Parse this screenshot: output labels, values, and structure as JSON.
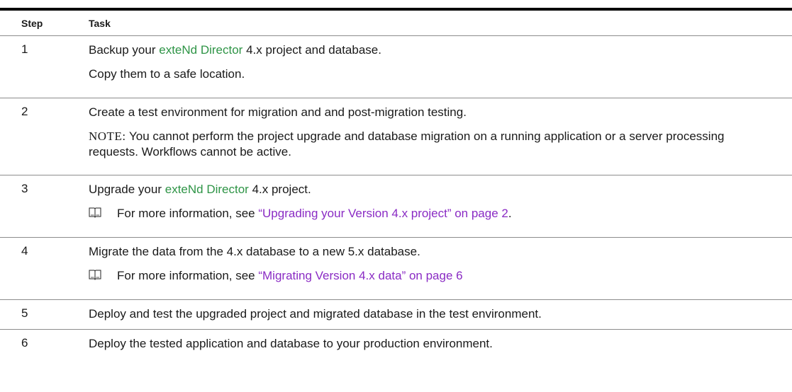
{
  "header": {
    "step": "Step",
    "task": "Task"
  },
  "rows": [
    {
      "step": "1",
      "line1": {
        "a": "Backup your ",
        "link": "exteNd Director",
        "b": " 4.x project and database."
      },
      "line2": "Copy them to a safe location."
    },
    {
      "step": "2",
      "line1": "Create a test environment for migration and and post-migration testing.",
      "note_label": "NOTE:",
      "note_text": " You cannot perform the project upgrade and database migration on a running application or a server processing requests. Workflows cannot be active."
    },
    {
      "step": "3",
      "line1": {
        "a": "Upgrade your ",
        "link": "exteNd Director",
        "b": " 4.x project."
      },
      "ref": {
        "icon": "book-icon",
        "prefix": "For more information, see ",
        "link": "“Upgrading your Version 4.x project” on page 2",
        "suffix": "."
      }
    },
    {
      "step": "4",
      "line1": "Migrate the data from the 4.x database to a new 5.x database.",
      "ref": {
        "icon": "book-icon",
        "prefix": "For more information, see ",
        "link": "“Migrating Version 4.x data” on page 6",
        "suffix": ""
      }
    },
    {
      "step": "5",
      "line1": "Deploy and test the upgraded project and migrated database in the test environment."
    },
    {
      "step": "6",
      "line1": "Deploy the tested application and database to your production environment."
    }
  ],
  "colors": {
    "product_link": "#2e9446",
    "xref_link": "#8a2bc4"
  }
}
